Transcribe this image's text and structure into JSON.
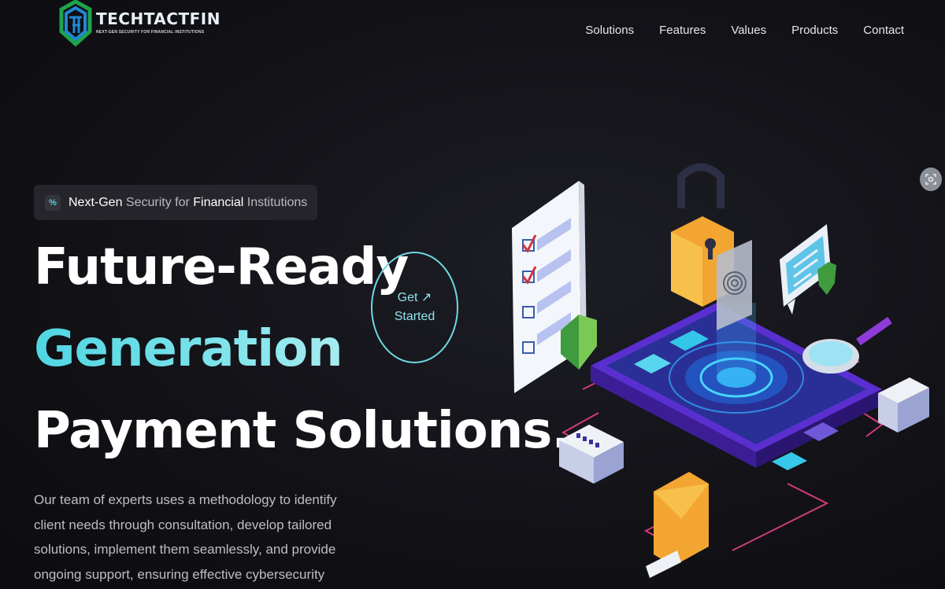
{
  "brand": {
    "name": "TECHTACTFIN",
    "tagline": "NEXT-GEN SECURITY FOR FINANCIAL INSTITUTIONS",
    "colors": {
      "green": "#1fa34a",
      "blue": "#1e88d6",
      "accent": "#4fd6e2"
    }
  },
  "nav": {
    "items": [
      "Solutions",
      "Features",
      "Values",
      "Products",
      "Contact"
    ]
  },
  "hero": {
    "badge_icon": "percent-icon",
    "badge_parts": [
      "Next-Gen",
      " Security for ",
      "Financial",
      " Institutions"
    ],
    "line1": "Future-Ready",
    "line2": "Generation",
    "line3": "Payment Solutions.",
    "cta_line1": "Get ↗",
    "cta_line2": "Started",
    "description": "Our team of experts uses a methodology to identify client needs through consultation, develop tailored solutions, implement them seamlessly, and provide ongoing support, ensuring effective cybersecurity"
  },
  "side_button_icon": "scan-icon"
}
